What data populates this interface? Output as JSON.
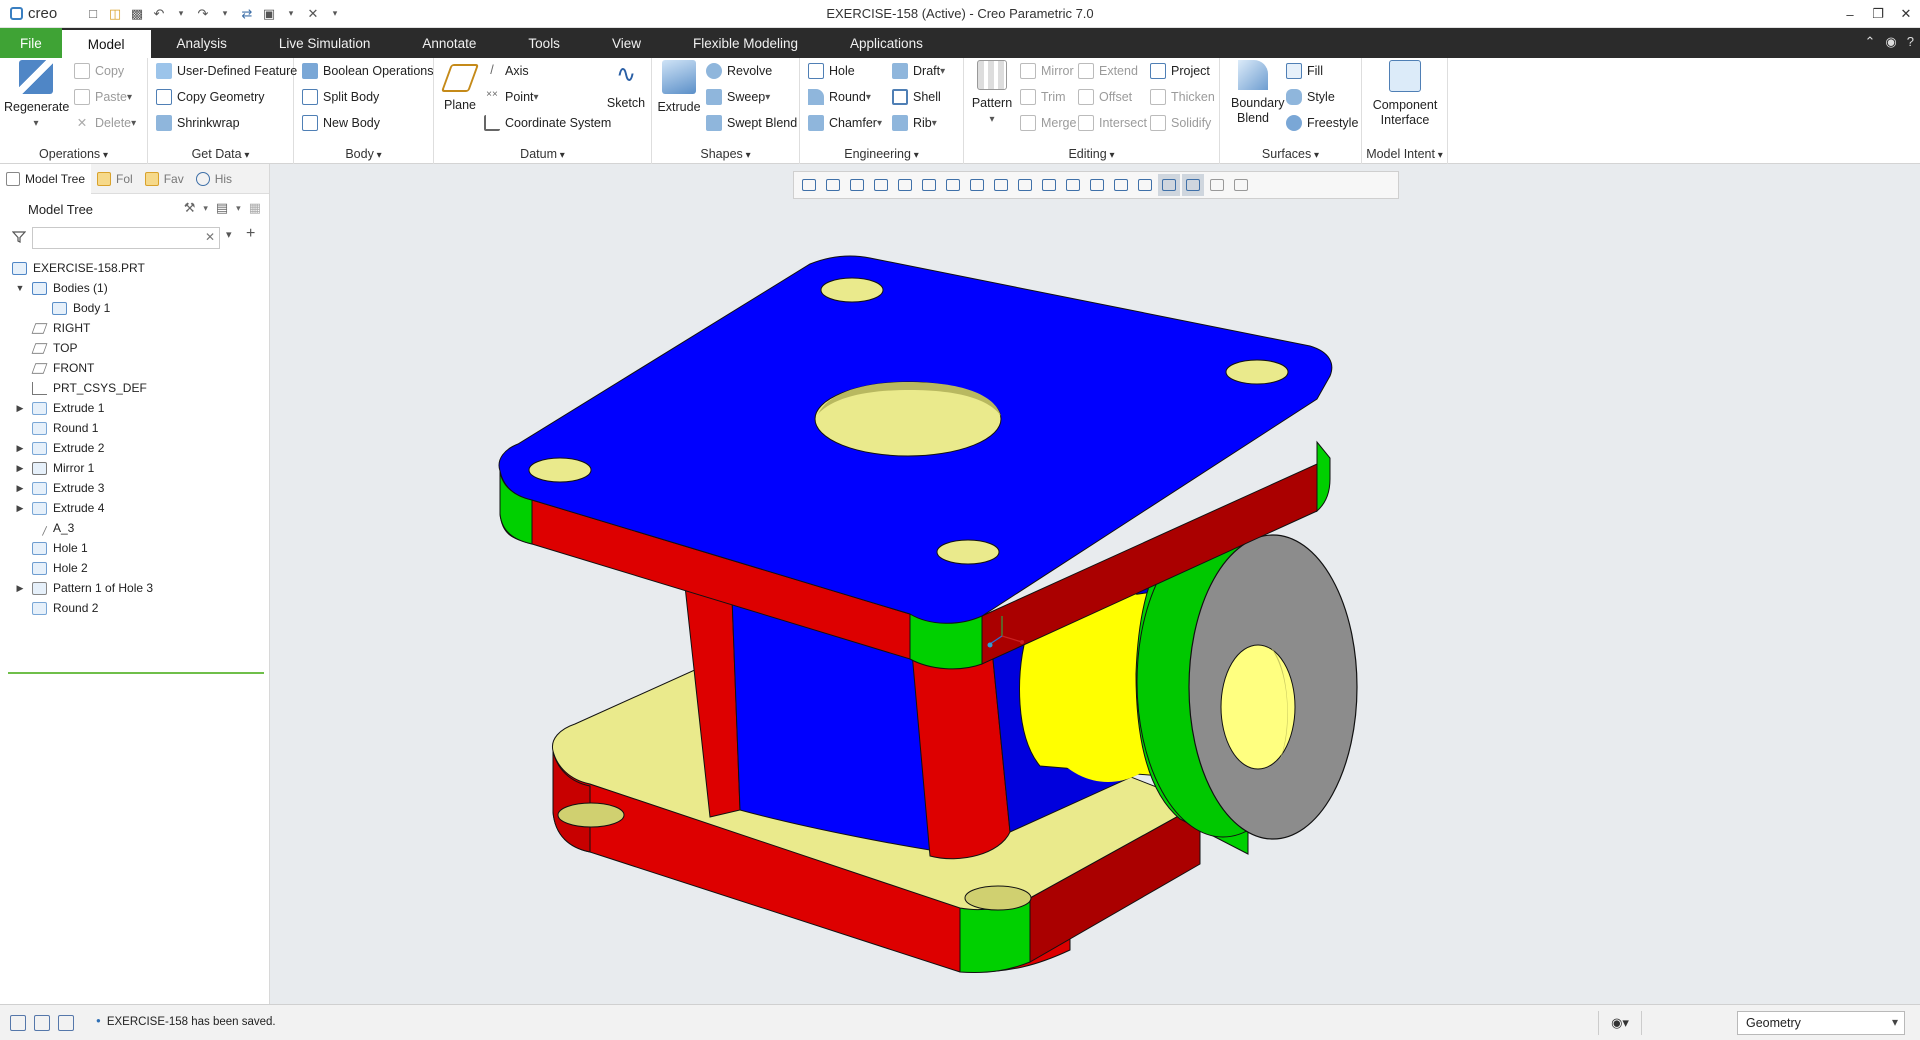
{
  "title_bar": {
    "logo_text": "creo",
    "window_title": "EXERCISE-158 (Active) - Creo Parametric 7.0",
    "controls": [
      "minimize-icon",
      "restore-icon",
      "close-icon"
    ]
  },
  "menu_tabs": [
    {
      "label": "File"
    },
    {
      "label": "Model"
    },
    {
      "label": "Analysis"
    },
    {
      "label": "Live Simulation"
    },
    {
      "label": "Annotate"
    },
    {
      "label": "Tools"
    },
    {
      "label": "View"
    },
    {
      "label": "Flexible Modeling"
    },
    {
      "label": "Applications"
    }
  ],
  "active_tab": "Model",
  "ribbon": {
    "operations": {
      "label": "Operations",
      "regenerate": "Regenerate",
      "copy": "Copy",
      "paste": "Paste",
      "delete": "Delete"
    },
    "get_data": {
      "label": "Get Data",
      "udf": "User-Defined Feature",
      "copy_geometry": "Copy Geometry",
      "shrinkwrap": "Shrinkwrap"
    },
    "body": {
      "label": "Body",
      "boolean": "Boolean Operations",
      "split": "Split Body",
      "new": "New Body"
    },
    "datum": {
      "label": "Datum",
      "plane": "Plane",
      "axis": "Axis",
      "point": "Point",
      "csys": "Coordinate System",
      "sketch": "Sketch"
    },
    "shapes": {
      "label": "Shapes",
      "extrude": "Extrude",
      "revolve": "Revolve",
      "sweep": "Sweep",
      "swept_blend": "Swept Blend"
    },
    "engineering": {
      "label": "Engineering",
      "hole": "Hole",
      "round": "Round",
      "chamfer": "Chamfer",
      "draft": "Draft",
      "shell": "Shell",
      "rib": "Rib"
    },
    "editing": {
      "label": "Editing",
      "pattern": "Pattern",
      "mirror": "Mirror",
      "trim": "Trim",
      "merge": "Merge",
      "extend": "Extend",
      "offset": "Offset",
      "intersect": "Intersect",
      "project": "Project",
      "thicken": "Thicken",
      "solidify": "Solidify"
    },
    "surfaces": {
      "label": "Surfaces",
      "boundary_blend": "Boundary Blend",
      "fill": "Fill",
      "style": "Style",
      "freestyle": "Freestyle"
    },
    "model_intent": {
      "label": "Model Intent",
      "component_interface": "Component Interface"
    }
  },
  "left_panel": {
    "tabs": [
      "Model Tree",
      "Fol",
      "Fav",
      "His"
    ],
    "tree_title": "Model Tree",
    "search_placeholder": "",
    "tree": [
      {
        "label": "EXERCISE-158.PRT",
        "level": 0,
        "expander": "",
        "icon": "part-icon"
      },
      {
        "label": "Bodies (1)",
        "level": 1,
        "expander": "open",
        "icon": "bodies-icon"
      },
      {
        "label": "Body 1",
        "level": 2,
        "expander": "",
        "icon": "body-icon"
      },
      {
        "label": "RIGHT",
        "level": 1,
        "expander": "",
        "icon": "datum-plane-icon"
      },
      {
        "label": "TOP",
        "level": 1,
        "expander": "",
        "icon": "datum-plane-icon"
      },
      {
        "label": "FRONT",
        "level": 1,
        "expander": "",
        "icon": "datum-plane-icon"
      },
      {
        "label": "PRT_CSYS_DEF",
        "level": 1,
        "expander": "",
        "icon": "csys-icon"
      },
      {
        "label": "Extrude 1",
        "level": 1,
        "expander": "closed",
        "icon": "extrude-icon"
      },
      {
        "label": "Round 1",
        "level": 1,
        "expander": "",
        "icon": "round-icon"
      },
      {
        "label": "Extrude 2",
        "level": 1,
        "expander": "closed",
        "icon": "extrude-icon"
      },
      {
        "label": "Mirror 1",
        "level": 1,
        "expander": "closed",
        "icon": "mirror-icon"
      },
      {
        "label": "Extrude 3",
        "level": 1,
        "expander": "closed",
        "icon": "extrude-icon"
      },
      {
        "label": "Extrude 4",
        "level": 1,
        "expander": "closed",
        "icon": "extrude-icon"
      },
      {
        "label": "A_3",
        "level": 1,
        "expander": "",
        "icon": "axis-icon"
      },
      {
        "label": "Hole 1",
        "level": 1,
        "expander": "",
        "icon": "hole-icon"
      },
      {
        "label": "Hole 2",
        "level": 1,
        "expander": "",
        "icon": "hole-icon"
      },
      {
        "label": "Pattern 1 of Hole 3",
        "level": 1,
        "expander": "closed",
        "icon": "pattern-icon"
      },
      {
        "label": "Round 2",
        "level": 1,
        "expander": "",
        "icon": "round-icon"
      }
    ]
  },
  "graphics_toolbar": [
    "refit-icon",
    "zoom-in-icon",
    "zoom-out-icon",
    "repaint-icon",
    "perspective-icon",
    "saved-orientations-icon",
    "named-views-icon",
    "display-style-icon",
    "section-icon",
    "annotation-display-icon",
    "datum-display-icon",
    "plane-display-icon",
    "axis-display-icon",
    "point-display-icon",
    "csys-display-icon",
    "spin-center-icon",
    "annotation-icon",
    "pause-icon",
    "next-icon"
  ],
  "status_bar": {
    "message": "EXERCISE-158 has been saved.",
    "selection_filter": "Geometry"
  },
  "colors": {
    "file_tab": "#3fa335",
    "tab_bar": "#2b2b2b",
    "viewport_bg": "#e8ebee",
    "model_blue": "#0000ff",
    "model_red": "#dd0000",
    "model_green": "#00d000",
    "model_yellow": "#ffff00",
    "model_pale_yellow": "#eaea8c",
    "model_gray": "#8c8c8c"
  }
}
